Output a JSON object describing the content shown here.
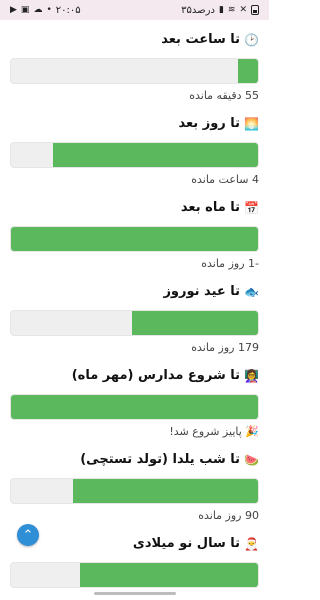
{
  "status": {
    "time": "۲۰:۰۵",
    "battery": "۳۵درصد"
  },
  "items": [
    {
      "emoji": "🕑",
      "title": "تا ساعت بعد",
      "progress": 0.08,
      "remaining": "55 دقیقه مانده"
    },
    {
      "emoji": "🌅",
      "title": "تا روز بعد",
      "progress": 0.83,
      "remaining": "4 ساعت مانده"
    },
    {
      "emoji": "📅",
      "title": "تا ماه بعد",
      "progress": 1.0,
      "remaining": "-1 روز مانده"
    },
    {
      "emoji": "🐟",
      "title": "تا عید نوروز",
      "progress": 0.51,
      "remaining": "179 روز مانده"
    },
    {
      "emoji": "👩‍🏫",
      "title": "تا شروع مدارس (مهر ماه)",
      "progress": 1.0,
      "remaining": "🎉 پاییز شروع شد!"
    },
    {
      "emoji": "🍉",
      "title": "تا شب یلدا (تولد تستچی)",
      "progress": 0.75,
      "remaining": "90 روز مانده"
    },
    {
      "emoji": "🎅",
      "title": "تا سال نو میلادی",
      "progress": 0.72,
      "remaining": ""
    }
  ],
  "colors": {
    "fill": "#5cb85c",
    "track": "#efefef",
    "fab": "#2f8fd6"
  },
  "fab_icon": "chevron-up-icon"
}
